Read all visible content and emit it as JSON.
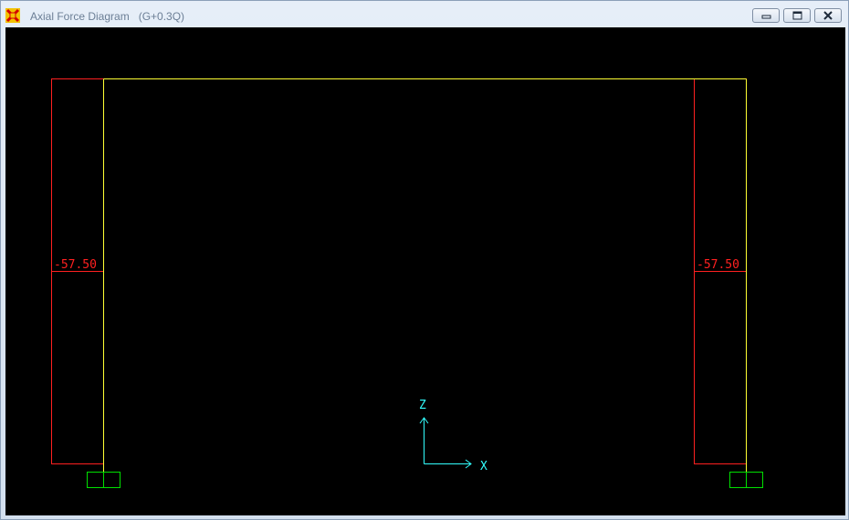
{
  "window": {
    "title": "Axial Force Diagram",
    "load_combination": "(G+0.3Q)"
  },
  "controls": {
    "minimize": "minimize-icon",
    "restore": "restore-icon",
    "close": "close-icon"
  },
  "diagram": {
    "left_column_value": "-57.50",
    "right_column_value": "-57.50",
    "axis_z_label": "Z",
    "axis_x_label": "X"
  },
  "colors": {
    "frame": "#ffff33",
    "axial_force": "#ff2020",
    "support": "#00e000",
    "axis": "#33ffff",
    "background": "#000000"
  }
}
